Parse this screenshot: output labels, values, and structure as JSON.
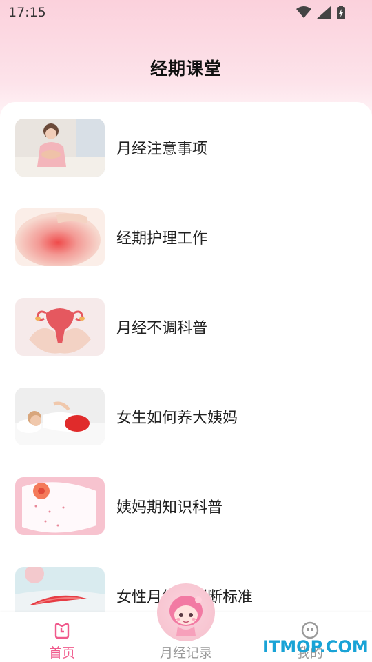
{
  "status_bar": {
    "time": "17:15"
  },
  "header": {
    "title": "经期课堂"
  },
  "articles": [
    {
      "label": "月经注意事项",
      "thumb": "woman-abdominal-pain-photo"
    },
    {
      "label": "经期护理工作",
      "thumb": "belly-red-glow-photo"
    },
    {
      "label": "月经不调科普",
      "thumb": "hands-uterus-model-photo"
    },
    {
      "label": "女生如何养大姨妈",
      "thumb": "woman-hot-water-bottle-photo"
    },
    {
      "label": "姨妈期知识科普",
      "thumb": "sanitary-pad-flower-photo"
    },
    {
      "label": "女性月经量判断标准",
      "thumb": "pad-red-feather-photo"
    }
  ],
  "tab_bar": {
    "tabs": [
      {
        "label": "首页",
        "icon": "home-icon",
        "active": true
      },
      {
        "label": "月经记录",
        "icon": "mascot-icon",
        "active": false
      },
      {
        "label": "我的",
        "icon": "profile-face-icon",
        "active": false
      }
    ],
    "active_color": "#f05a8c",
    "inactive_color": "#9a9a9a"
  },
  "watermark": {
    "text": "ITMOP.COM"
  }
}
